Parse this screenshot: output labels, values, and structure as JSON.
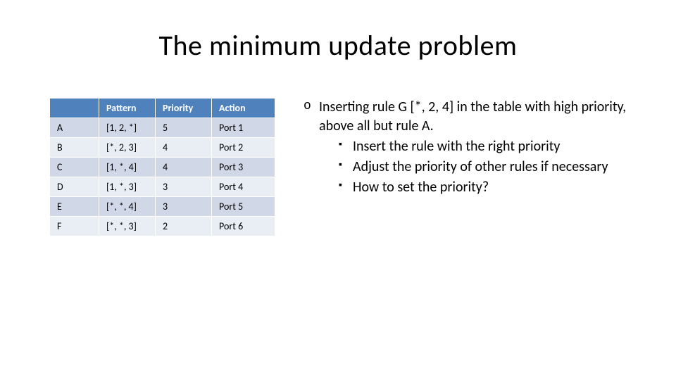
{
  "title": "The minimum update problem",
  "table": {
    "headers": {
      "blank": "",
      "pattern": "Pattern",
      "priority": "Priority",
      "action": "Action"
    },
    "rows": [
      {
        "id": "A",
        "pattern": "[1, 2, *]",
        "priority": "5",
        "action": "Port 1"
      },
      {
        "id": "B",
        "pattern": "[*, 2, 3]",
        "priority": "4",
        "action": "Port 2"
      },
      {
        "id": "C",
        "pattern": "[1, *, 4]",
        "priority": "4",
        "action": "Port 3"
      },
      {
        "id": "D",
        "pattern": "[1, *, 3]",
        "priority": "3",
        "action": "Port 4"
      },
      {
        "id": "E",
        "pattern": "[*, *, 4]",
        "priority": "3",
        "action": "Port 5"
      },
      {
        "id": "F",
        "pattern": "[*, *, 3]",
        "priority": "2",
        "action": "Port 6"
      }
    ]
  },
  "bullets": {
    "main": "Inserting rule G [*, 2, 4]  in the table with high priority, above all but rule A.",
    "subs": [
      "Insert the rule with the right priority",
      "Adjust the priority of other rules if necessary",
      "How to set the priority?"
    ]
  }
}
